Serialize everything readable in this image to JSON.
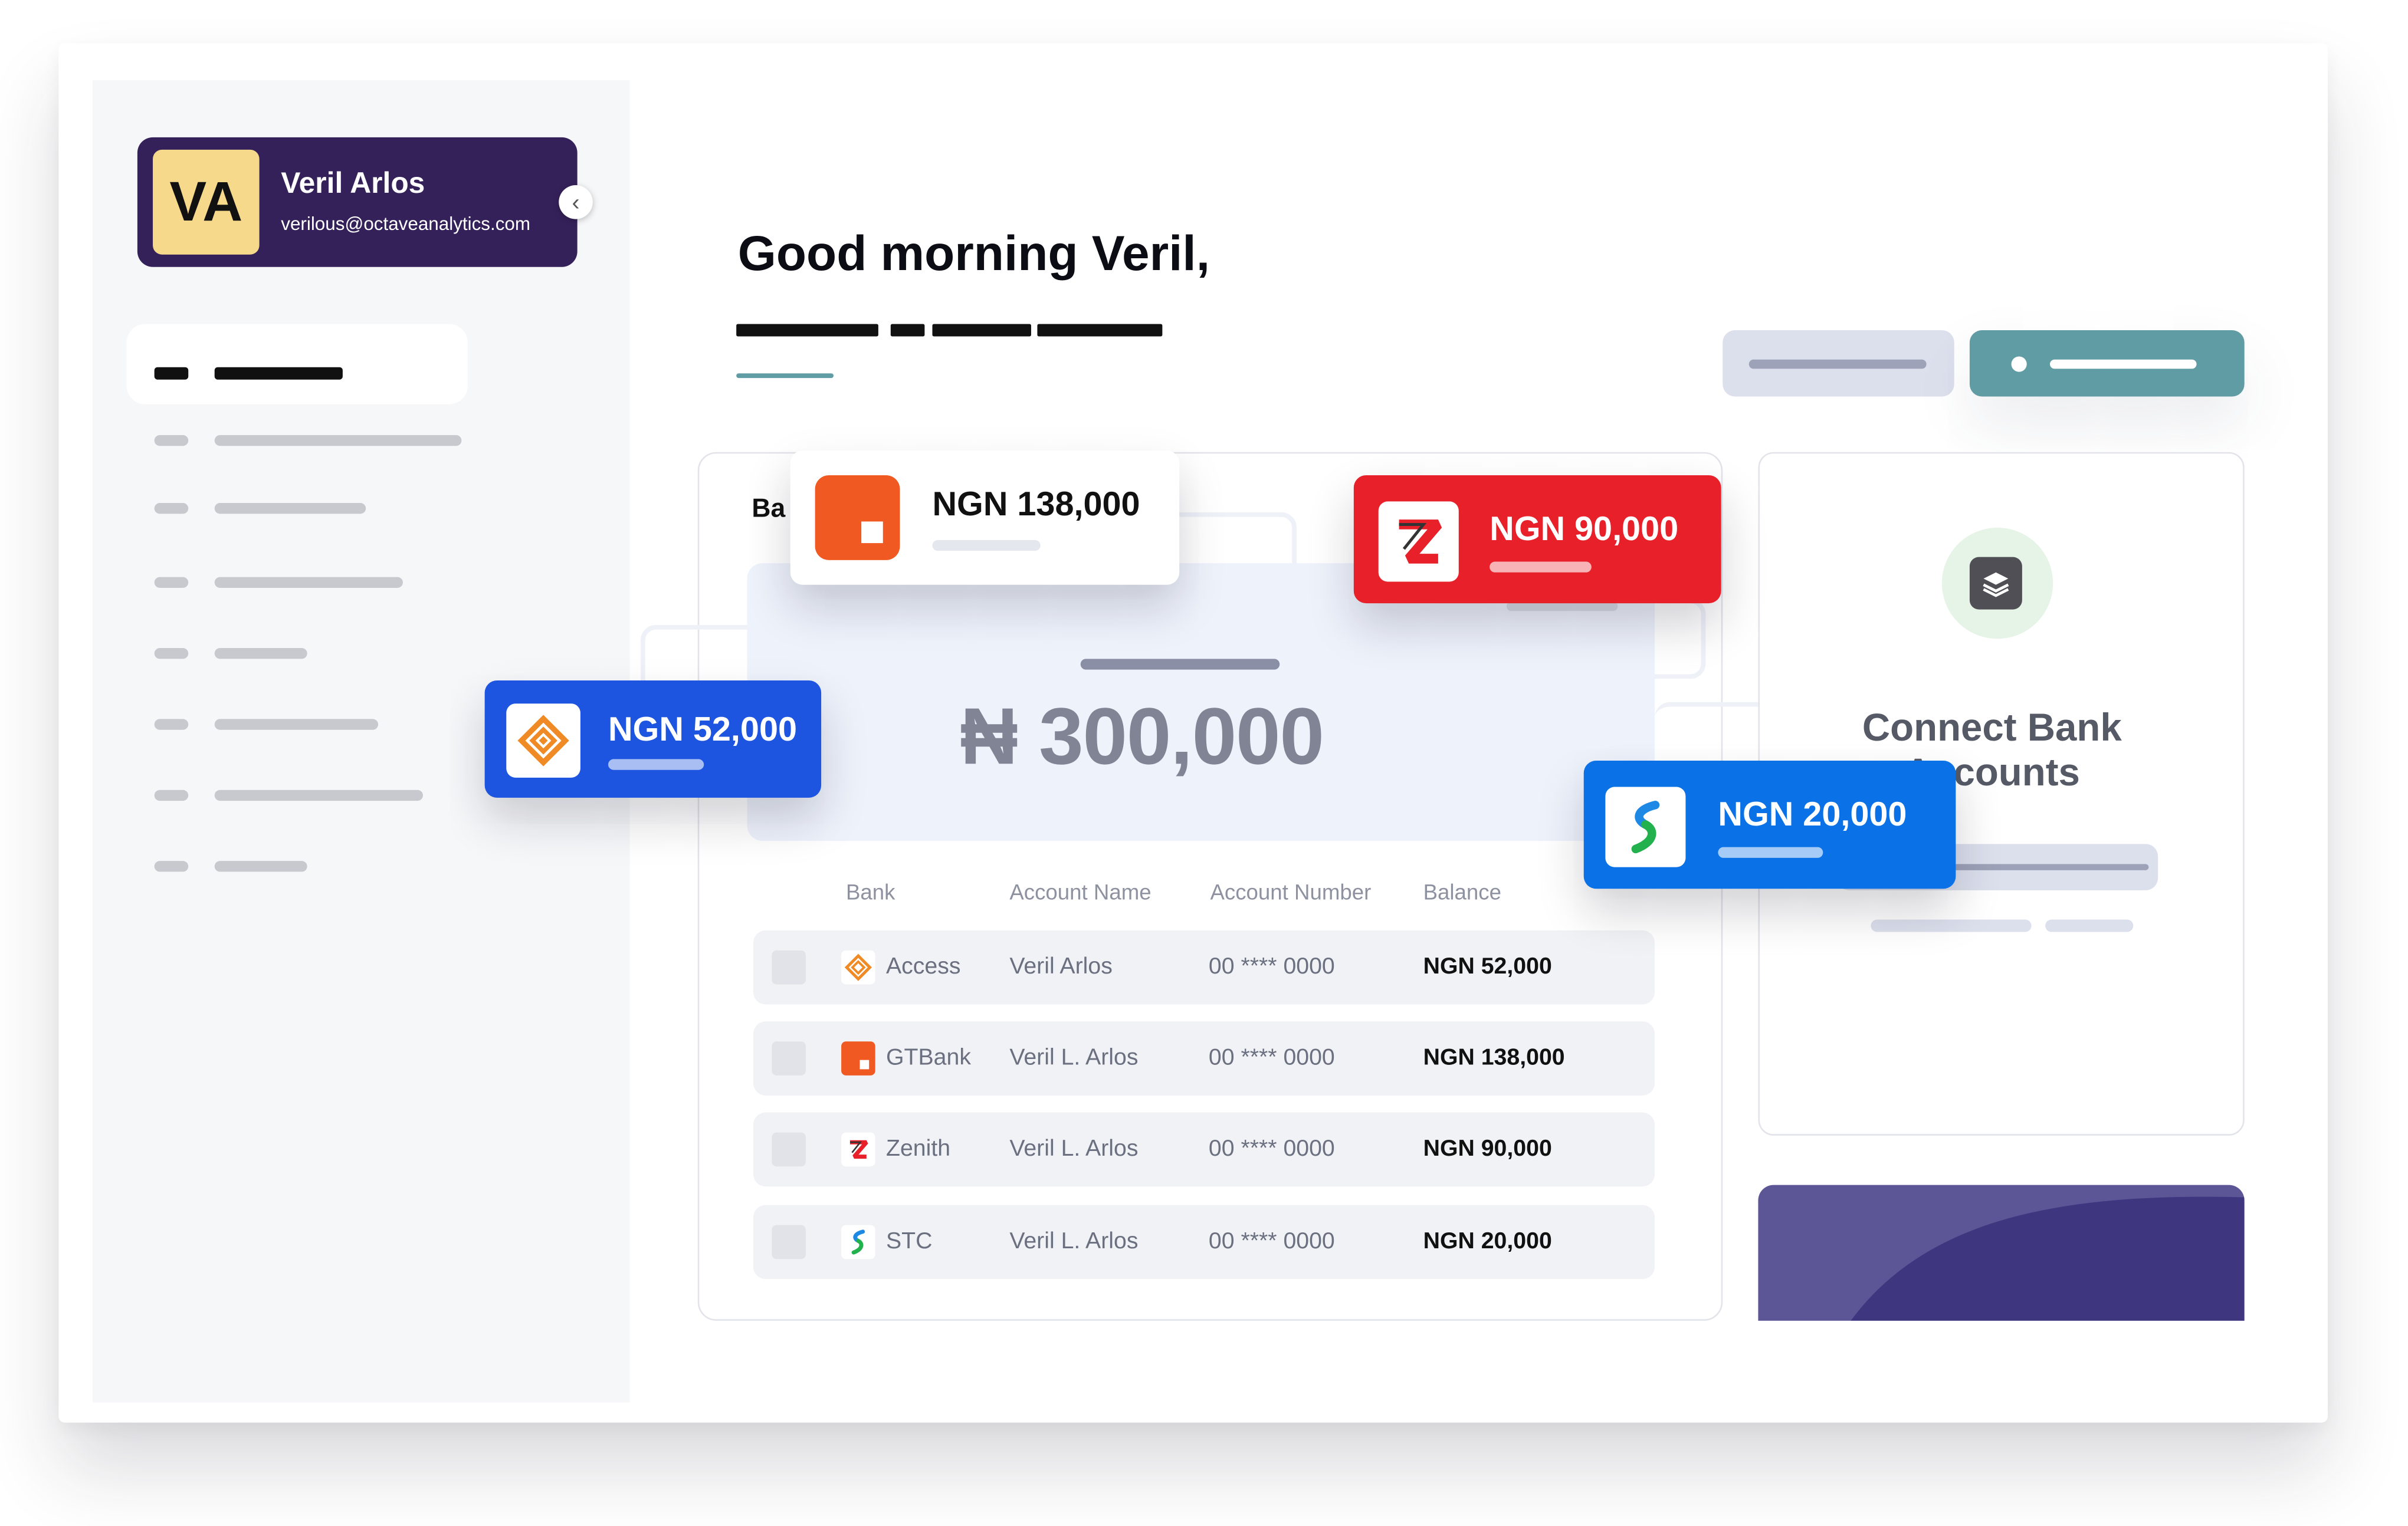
{
  "user": {
    "initials": "VA",
    "name": "Veril Arlos",
    "email": "verilous@octaveanalytics.com"
  },
  "greeting": "Good morning Veril,",
  "balance_card": {
    "title_visible": "Ba",
    "total": "₦ 300,000"
  },
  "table": {
    "headers": {
      "bank": "Bank",
      "account_name": "Account Name",
      "account_number": "Account Number",
      "balance": "Balance"
    },
    "rows": [
      {
        "bank": "Access",
        "name": "Veril Arlos",
        "number": "00 **** 0000",
        "balance": "NGN 52,000",
        "logo": "access-bank-icon"
      },
      {
        "bank": "GTBank",
        "name": "Veril L. Arlos",
        "number": "00 **** 0000",
        "balance": "NGN 138,000",
        "logo": "gtbank-icon"
      },
      {
        "bank": "Zenith",
        "name": "Veril L. Arlos",
        "number": "00 **** 0000",
        "balance": "NGN 90,000",
        "logo": "zenith-bank-icon"
      },
      {
        "bank": "STC",
        "name": "Veril L. Arlos",
        "number": "00 **** 0000",
        "balance": "NGN 20,000",
        "logo": "stanbic-bank-icon"
      }
    ]
  },
  "floating_cards": {
    "gtbank": {
      "amount": "NGN 138,000",
      "color": "#ffffff",
      "logo_color": "#f05a22"
    },
    "zenith": {
      "amount": "NGN 90,000",
      "color": "#e8202a"
    },
    "access": {
      "amount": "NGN 52,000",
      "color": "#1e55e0",
      "logo_color": "#f08a24"
    },
    "stanbic": {
      "amount": "NGN 20,000",
      "color": "#0a72e6"
    }
  },
  "connect_panel": {
    "title_line1": "Connect Bank",
    "title_line2": "Accounts",
    "icon": "layers-icon"
  },
  "colors": {
    "profile_bg": "#35215a",
    "avatar_bg": "#f7d98c",
    "primary_button": "#5f9ca4",
    "secondary_button": "#dcdfec",
    "sidebar_bg": "#f6f7f9"
  }
}
